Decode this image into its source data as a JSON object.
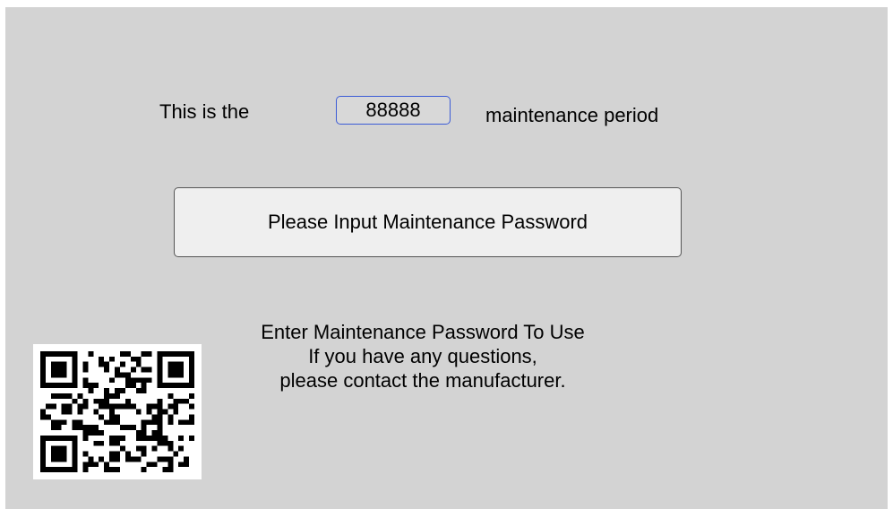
{
  "period": {
    "prefix": "This is the",
    "value": "88888",
    "suffix": "maintenance period"
  },
  "password_button_label": "Please Input Maintenance Password",
  "info": {
    "line1": "Enter Maintenance Password To Use",
    "line2": "If you have any questions,",
    "line3": "please contact the manufacturer."
  },
  "qr_icon": "qr-code-icon",
  "colors": {
    "background": "#d3d3d3",
    "accent_border": "#3b5bd6"
  }
}
